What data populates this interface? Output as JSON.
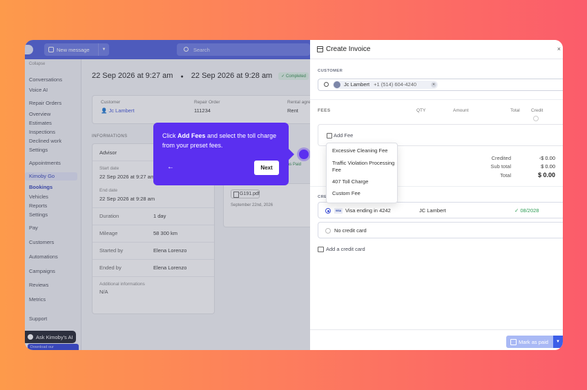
{
  "topbar": {
    "new_message": "New message",
    "search_placeholder": "Search"
  },
  "sidebar": {
    "collapse": "Collapse",
    "items": [
      "Conversations",
      "Voice AI",
      "Repair Orders",
      "Overview",
      "Estimates",
      "Inspections",
      "Declined work",
      "Settings",
      "Appointments",
      "Kimoby Go",
      "Bookings",
      "Vehicles",
      "Reports",
      "Settings",
      "Pay",
      "Customers",
      "Automations",
      "Campaigns",
      "Reviews",
      "Metrics",
      "Support"
    ],
    "ask_ai": "Ask Kimoby's AI",
    "download": "Download our"
  },
  "content": {
    "date_start": "22 Sep 2026 at 9:27 am",
    "date_end": "22 Sep 2026 at 9:28 am",
    "status": "Completed",
    "customer_label": "Customer",
    "customer_name": "Jc Lambert",
    "repair_order_label": "Repair Order",
    "repair_order_value": "111234",
    "rental_label": "Rental agre",
    "rental_value": "Rent",
    "informations": "INFORMATIONS",
    "advisor": "Advisor",
    "start_date_label": "Start date",
    "start_date_value": "22 Sep 2026 at 9:27 am",
    "end_date_label": "End date",
    "end_date_value": "22 Sep 2026 at 9:28 am",
    "duration_label": "Duration",
    "duration_value": "1 day",
    "mileage_label": "Mileage",
    "mileage_value": "58 300 km",
    "started_by_label": "Started by",
    "started_by_value": "Elena Lorenzo",
    "ended_by_label": "Ended by",
    "ended_by_value": "Elena Lorenzo",
    "additional_label": "Additional informations",
    "additional_value": "N/A",
    "pdf_name": "G191.pdf",
    "pdf_date": "September 22nd, 2026",
    "mark_paid_partial": "d as Paid"
  },
  "tooltip": {
    "pre": "Click ",
    "bold": "Add Fees",
    "post": " and select the toll charge from your preset fees.",
    "back": "←",
    "next": "Next"
  },
  "panel": {
    "title": "Create Invoice",
    "close": "×",
    "customer_section": "CUSTOMER",
    "customer_name": "Jc Lambert",
    "customer_phone": "+1 (514) 604-4240",
    "fees_headers": [
      "FEES",
      "QTY",
      "Amount",
      "Total",
      "Credit"
    ],
    "add_fee": "Add Fee",
    "fee_options": [
      "Excessive Cleaning Fee",
      "Traffic Violation Processing Fee",
      "407 Toll Charge",
      "Custom Fee"
    ],
    "totals": [
      {
        "label": "Credited",
        "value": "-$ 0.00"
      },
      {
        "label": "Sub total",
        "value": "$ 0.00"
      },
      {
        "label": "Total",
        "value": "$ 0.00"
      }
    ],
    "credit_section": "CRE",
    "visa_label": "VISA",
    "card_text": "Visa ending in 4242",
    "card_holder": "JC Lambert",
    "card_expiry": "✓ 08/2028",
    "no_credit_card": "No credit card",
    "add_credit_card": "Add a credit card",
    "mark_as_paid": "Mark as paid"
  }
}
